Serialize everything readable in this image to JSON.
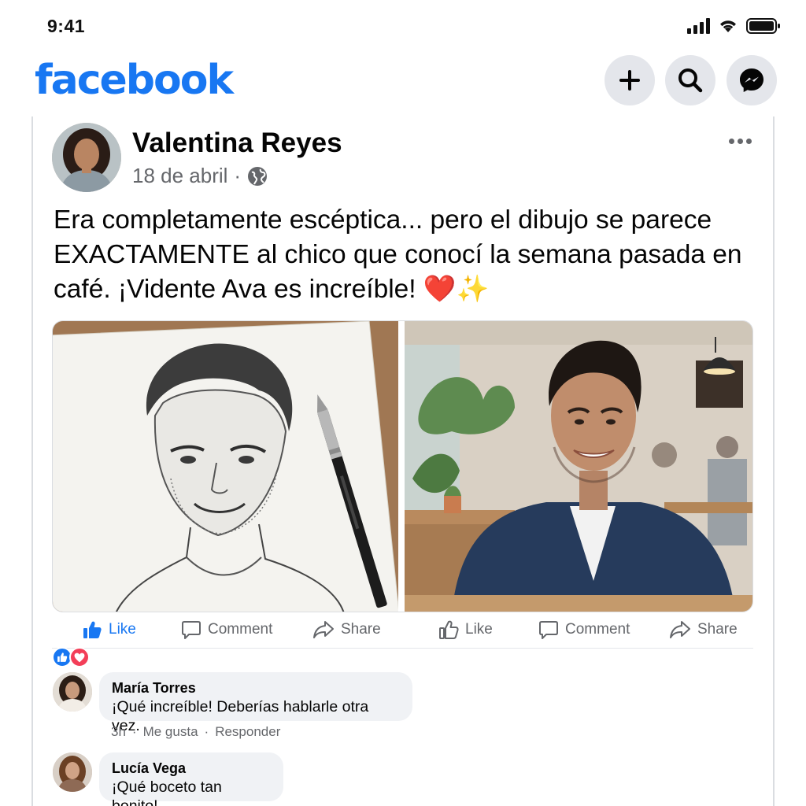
{
  "status_bar": {
    "time": "9:41"
  },
  "header": {
    "logo": "facebook",
    "icons": [
      "plus-icon",
      "search-icon",
      "messenger-icon"
    ]
  },
  "post": {
    "author": "Valentina Reyes",
    "date": "18 de abril",
    "separator": "·",
    "privacy_icon": "globe-icon",
    "text": "Era completamente escéptica... pero el dibujo se parece EXACTAMENTE al chico que conocí la semana pasada en café. ¡Vidente Ava es increíble! ❤️✨",
    "images": [
      "pencil-sketch-portrait",
      "cafe-photo-man"
    ]
  },
  "actions": {
    "left": {
      "like": "Like",
      "comment": "Comment",
      "share": "Share"
    },
    "right": {
      "like": "Like",
      "comment": "Comment",
      "share": "Share"
    }
  },
  "reactions": [
    "like",
    "love"
  ],
  "comments": [
    {
      "name": "María Torres",
      "text": "¡Qué increíble! Deberías hablarle otra vez.",
      "time": "3h",
      "like_label": "Me gusta",
      "reply_label": "Responder"
    },
    {
      "name": "Lucía Vega",
      "text": "¡Qué boceto tan bonito!"
    }
  ],
  "colors": {
    "brand": "#1877f2",
    "love": "#f33e58",
    "muted": "#65676b",
    "bubble": "#f0f2f5"
  }
}
